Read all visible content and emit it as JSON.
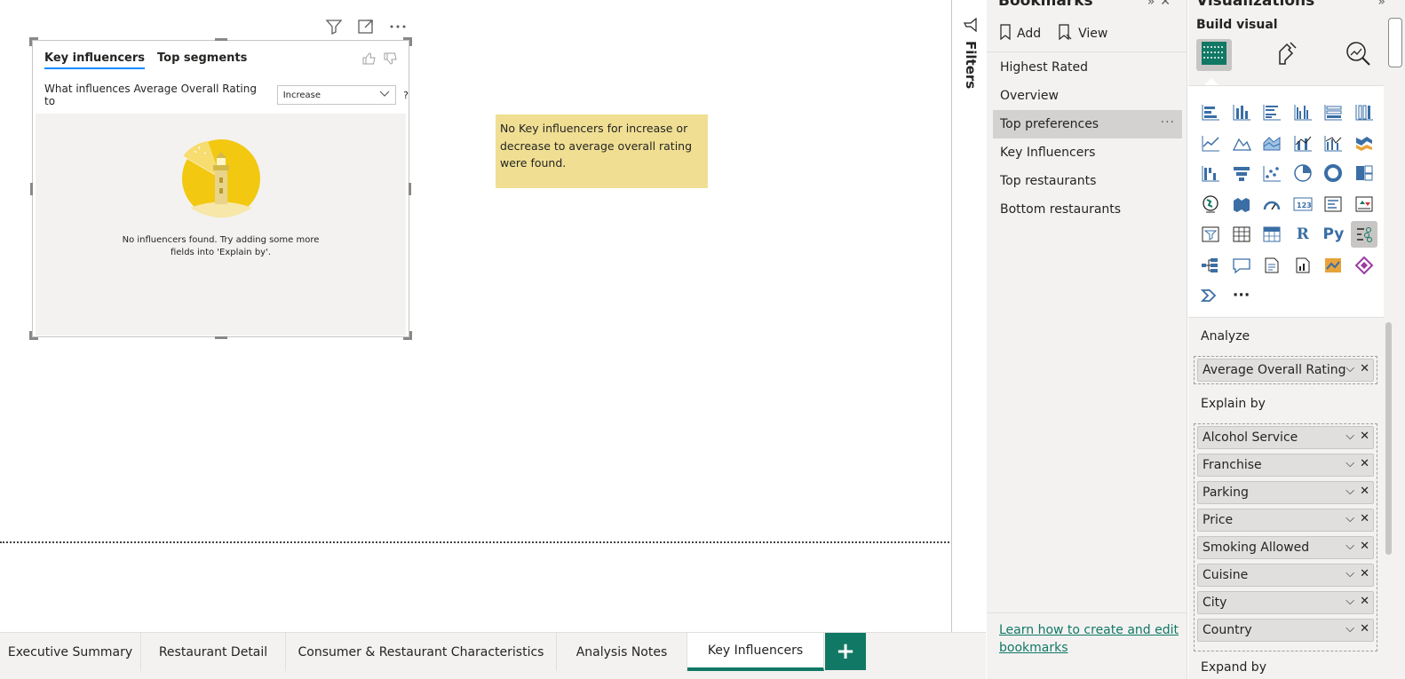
{
  "visual_toolbar": {
    "filter_icon": "filter-icon",
    "focus_icon": "focus-mode-icon",
    "more_icon": "more-options-icon"
  },
  "key_influencers": {
    "tabs": [
      "Key influencers",
      "Top segments"
    ],
    "question": "What influences Average Overall Rating to",
    "dropdown_value": "Increase",
    "help": "?",
    "empty_message_line1": "No influencers found. Try adding some more",
    "empty_message_line2": "fields into 'Explain by'."
  },
  "note": {
    "text": "No Key influencers for increase or decrease to average overall rating were found."
  },
  "page_tabs": [
    {
      "label": "Executive Summary",
      "active": false
    },
    {
      "label": "Restaurant Detail",
      "active": false
    },
    {
      "label": "Consumer & Restaurant Characteristics",
      "active": false
    },
    {
      "label": "Analysis Notes",
      "active": false
    },
    {
      "label": "Key Influencers",
      "active": true
    }
  ],
  "add_page_label": "+",
  "filters": {
    "label": "Filters"
  },
  "bookmarks": {
    "title": "Bookmarks",
    "add_label": "Add",
    "view_label": "View",
    "items": [
      "Highest Rated",
      "Overview",
      "Top preferences",
      "Key Influencers",
      "Top restaurants",
      "Bottom restaurants"
    ],
    "selected_index": 2,
    "more": "···",
    "learn_link": "Learn how to create and edit bookmarks"
  },
  "visualizations": {
    "title": "Visualizations",
    "build_visual": "Build visual",
    "analyze_label": "Analyze",
    "analyze_fields": [
      "Average Overall Rating"
    ],
    "explain_label": "Explain by",
    "explain_fields": [
      "Alcohol Service",
      "Franchise",
      "Parking",
      "Price",
      "Smoking Allowed",
      "Cuisine",
      "City",
      "Country"
    ],
    "format_label": "Expand by",
    "gallery_text_icons": {
      "r": "R",
      "py": "Py",
      "more": "···",
      "card": "123"
    }
  },
  "colors": {
    "accent": "#117865",
    "note_bg": "#f0df93",
    "tab_underline": "#118dff"
  }
}
